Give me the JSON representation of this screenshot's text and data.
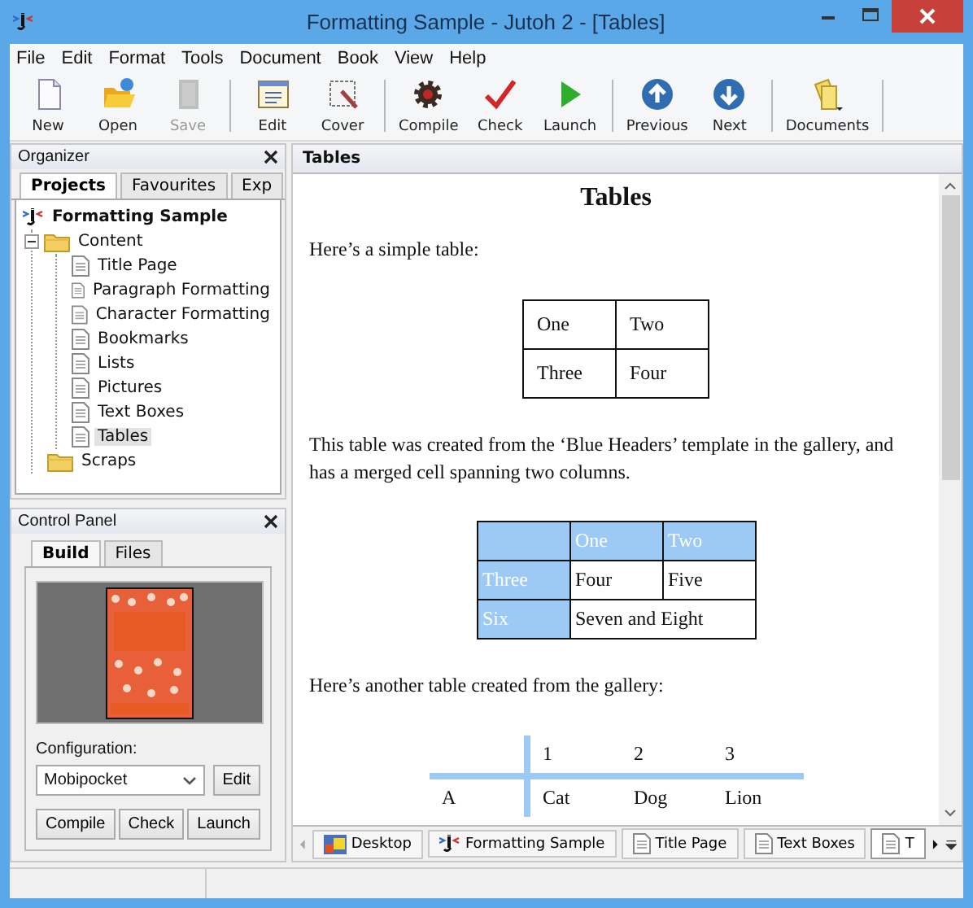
{
  "window": {
    "title": "Formatting Sample - Jutoh 2 - [Tables]"
  },
  "menu": [
    "File",
    "Edit",
    "Format",
    "Tools",
    "Document",
    "Book",
    "View",
    "Help"
  ],
  "toolbar": [
    [
      {
        "label": "New",
        "disabled": false
      },
      {
        "label": "Open",
        "disabled": false
      },
      {
        "label": "Save",
        "disabled": true
      }
    ],
    [
      {
        "label": "Edit",
        "disabled": false
      },
      {
        "label": "Cover",
        "disabled": false
      }
    ],
    [
      {
        "label": "Compile",
        "disabled": false
      },
      {
        "label": "Check",
        "disabled": false
      },
      {
        "label": "Launch",
        "disabled": false
      }
    ],
    [
      {
        "label": "Previous",
        "disabled": false
      },
      {
        "label": "Next",
        "disabled": false
      }
    ],
    [
      {
        "label": "Documents",
        "disabled": false
      }
    ]
  ],
  "organizer": {
    "title": "Organizer",
    "tabs": [
      {
        "label": "Projects",
        "selected": true
      },
      {
        "label": "Favourites",
        "selected": false
      },
      {
        "label": "Exp",
        "selected": false
      }
    ],
    "tree": [
      {
        "label": "Formatting Sample",
        "kind": "project",
        "selected": false,
        "children": [
          {
            "label": "Content",
            "kind": "folder",
            "selected": false,
            "expanded": true,
            "children": [
              {
                "label": "Title Page",
                "kind": "page",
                "selected": false
              },
              {
                "label": "Paragraph Formatting",
                "kind": "page",
                "selected": false
              },
              {
                "label": "Character Formatting",
                "kind": "page",
                "selected": false
              },
              {
                "label": "Bookmarks",
                "kind": "page",
                "selected": false
              },
              {
                "label": "Lists",
                "kind": "page",
                "selected": false
              },
              {
                "label": "Pictures",
                "kind": "page",
                "selected": false
              },
              {
                "label": "Text Boxes",
                "kind": "page",
                "selected": false
              },
              {
                "label": "Tables",
                "kind": "page",
                "selected": true
              }
            ]
          },
          {
            "label": "Scraps",
            "kind": "folder",
            "selected": false
          }
        ]
      }
    ]
  },
  "control_panel": {
    "title": "Control Panel",
    "tabs": [
      {
        "label": "Build",
        "selected": true
      },
      {
        "label": "Files",
        "selected": false
      }
    ],
    "cover": {
      "kind": "picture"
    },
    "configuration_label": "Configuration:",
    "configuration": {
      "value": "Mobipocket"
    },
    "edit_button": "Edit",
    "buttons": [
      "Compile",
      "Check",
      "Launch"
    ]
  },
  "document": {
    "title": "Tables",
    "blocks": [
      {
        "kind": "heading",
        "text": "Tables"
      },
      {
        "kind": "paragraph",
        "text": "Here’s a simple table:"
      },
      {
        "kind": "plain_table",
        "rows": [
          [
            {
              "text": "One"
            },
            {
              "text": "Two"
            }
          ],
          [
            {
              "text": "Three"
            },
            {
              "text": "Four"
            }
          ]
        ]
      },
      {
        "kind": "paragraph",
        "text": "This table was created from the ‘Blue Headers’ template in the gallery, and has a merged cell spanning two columns."
      },
      {
        "kind": "blue_table",
        "rows": [
          [
            {
              "header": true
            },
            {
              "text": "One",
              "header": true
            },
            {
              "text": "Two",
              "header": true
            }
          ],
          [
            {
              "text": "Three",
              "header": true
            },
            {
              "text": "Four",
              "header": false
            },
            {
              "text": "Five",
              "header": false
            }
          ],
          [
            {
              "text": "Six",
              "header": true
            },
            {
              "text": "Seven and Eight",
              "header": false,
              "colspan": 2
            }
          ]
        ]
      },
      {
        "kind": "paragraph",
        "text": "Here’s another table created from the gallery:"
      },
      {
        "kind": "lines_table",
        "rows": [
          [
            {},
            {
              "text": "1"
            },
            {
              "text": "2"
            },
            {
              "text": "3"
            }
          ],
          [
            {
              "text": "A"
            },
            {
              "text": "Cat"
            },
            {
              "text": "Dog"
            },
            {
              "text": "Lion"
            }
          ]
        ]
      }
    ]
  },
  "bottom_tabs": [
    {
      "label": "Desktop",
      "kind": "desktop",
      "selected": false
    },
    {
      "label": "Formatting Sample",
      "kind": "project",
      "selected": false
    },
    {
      "label": "Title Page",
      "kind": "page",
      "selected": false
    },
    {
      "label": "Text Boxes",
      "kind": "page",
      "selected": false
    },
    {
      "label": "T",
      "kind": "page",
      "selected": true
    }
  ]
}
